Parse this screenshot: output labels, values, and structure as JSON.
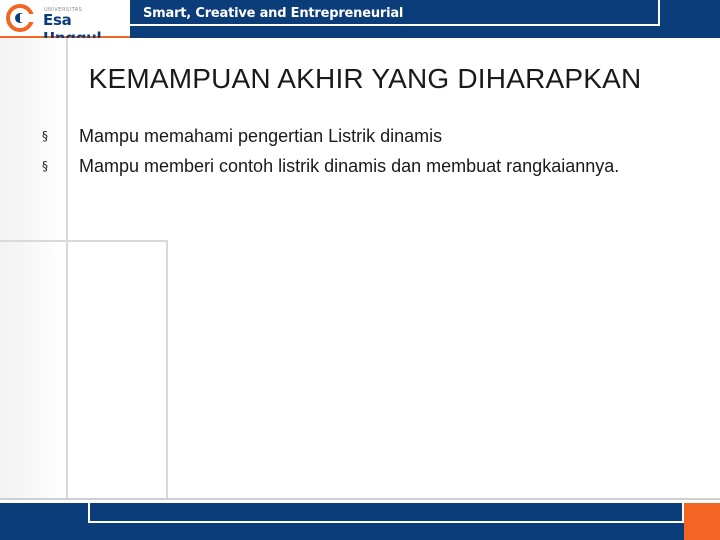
{
  "header": {
    "logo_small": "UNIVERSITAS",
    "logo_name": "Esa Unggul",
    "tagline": "Smart, Creative and Entrepreneurial"
  },
  "slide": {
    "title": "KEMAMPUAN AKHIR YANG DIHARAPKAN",
    "bullet_marker": "§",
    "bullets": [
      "Mampu memahami pengertian Listrik dinamis",
      "Mampu memberi contoh listrik dinamis dan membuat rangkaiannya."
    ]
  },
  "colors": {
    "brand_blue": "#0b3d7a",
    "brand_orange": "#f26522"
  }
}
